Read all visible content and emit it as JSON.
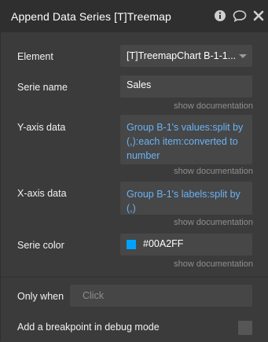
{
  "window": {
    "title": "Append Data Series [T]Treemap"
  },
  "icons": {
    "info": "info-icon",
    "comment": "comment-icon",
    "close": "close-icon",
    "dropdown": "chevron-down-icon"
  },
  "fields": {
    "element": {
      "label": "Element",
      "value": "[T]TreemapChart B-1-1..."
    },
    "serie_name": {
      "label": "Serie name",
      "value": "Sales"
    },
    "y_axis": {
      "label": "Y-axis data",
      "value": "Group B-1's values:split by (,):each item:converted to number"
    },
    "x_axis": {
      "label": "X-axis data",
      "value": "Group B-1's labels:split by (,)"
    },
    "serie_color": {
      "label": "Serie color",
      "value": "#00A2FF",
      "swatch": "#00A2FF"
    }
  },
  "doc_link": "show documentation",
  "only_when": {
    "label": "Only when",
    "placeholder": "Click"
  },
  "breakpoint": {
    "label": "Add a breakpoint in debug mode",
    "checked": false
  },
  "colors": {
    "titlebar": "#2f2f2f",
    "panel": "#3b3b3b",
    "field": "#474747",
    "dynamic_text": "#6ab3f5",
    "accent": "#00A2FF"
  }
}
